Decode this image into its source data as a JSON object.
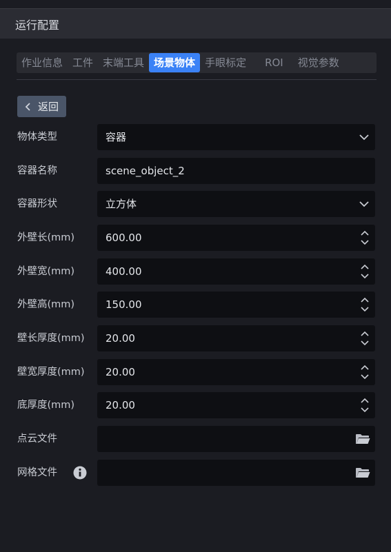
{
  "header": {
    "title": "运行配置"
  },
  "tabs": [
    {
      "label": "作业信息",
      "active": false
    },
    {
      "label": "工件",
      "active": false
    },
    {
      "label": "末端工具",
      "active": false
    },
    {
      "label": "场景物体",
      "active": true
    },
    {
      "label": "手眼标定",
      "active": false
    },
    {
      "label": "ROI",
      "active": false
    },
    {
      "label": "视觉参数",
      "active": false
    }
  ],
  "back_button": {
    "label": "返回"
  },
  "form": {
    "object_type": {
      "label": "物体类型",
      "value": "容器"
    },
    "container_name": {
      "label": "容器名称",
      "value": "scene_object_2"
    },
    "container_shape": {
      "label": "容器形状",
      "value": "立方体"
    },
    "outer_length": {
      "label": "外壁长(mm)",
      "value": "600.00"
    },
    "outer_width": {
      "label": "外壁宽(mm)",
      "value": "400.00"
    },
    "outer_height": {
      "label": "外壁高(mm)",
      "value": "150.00"
    },
    "wall_length_thickness": {
      "label": "壁长厚度(mm)",
      "value": "20.00"
    },
    "wall_width_thickness": {
      "label": "壁宽厚度(mm)",
      "value": "20.00"
    },
    "bottom_thickness": {
      "label": "底厚度(mm)",
      "value": "20.00"
    },
    "point_cloud_file": {
      "label": "点云文件",
      "value": ""
    },
    "mesh_file": {
      "label": "网格文件",
      "value": ""
    }
  },
  "colors": {
    "accent": "#3b82f6",
    "background": "#1b1c22",
    "field_bg": "#0e0f13",
    "back_button_bg": "#4a5568"
  },
  "icons": {
    "select": "chevron-down-icon",
    "number": "spinner-icon",
    "file": "folder-icon",
    "info": "info-icon",
    "back": "chevron-left-icon"
  }
}
